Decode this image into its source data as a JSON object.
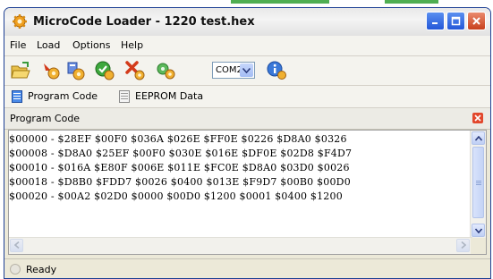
{
  "window": {
    "title": "MicroCode Loader - 1220 test.hex"
  },
  "menu": [
    "File",
    "Load",
    "Options",
    "Help"
  ],
  "toolbar": {
    "port_value": "COM2",
    "icons": [
      "open-folder-icon",
      "read-device-icon",
      "write-device-icon",
      "verify-icon",
      "erase-icon",
      "configure-icon",
      "info-icon"
    ]
  },
  "tabs": [
    {
      "label": "Program Code",
      "active": true
    },
    {
      "label": "EEPROM Data",
      "active": false
    }
  ],
  "panel": {
    "title": "Program Code"
  },
  "code_lines": [
    "$00000 - $28EF $00F0 $036A $026E $FF0E $0226 $D8A0 $0326",
    "$00008 - $D8A0 $25EF $00F0 $030E $016E $DF0E $02D8 $F4D7",
    "$00010 - $016A $E80F $006E $011E $FC0E $D8A0 $03D0 $0026",
    "$00018 - $D8B0 $FDD7 $0026 $0400 $013E $F9D7 $00B0 $00D0",
    "$00020 - $00A2 $02D0 $0000 $00D0 $1200 $0001 $0400 $1200"
  ],
  "status": {
    "text": "Ready"
  },
  "colors": {
    "title_bar": "#e8e8e8",
    "window_frame": "#1c3f94",
    "close_button": "#c8401d",
    "panel_close": "#e2472c"
  }
}
